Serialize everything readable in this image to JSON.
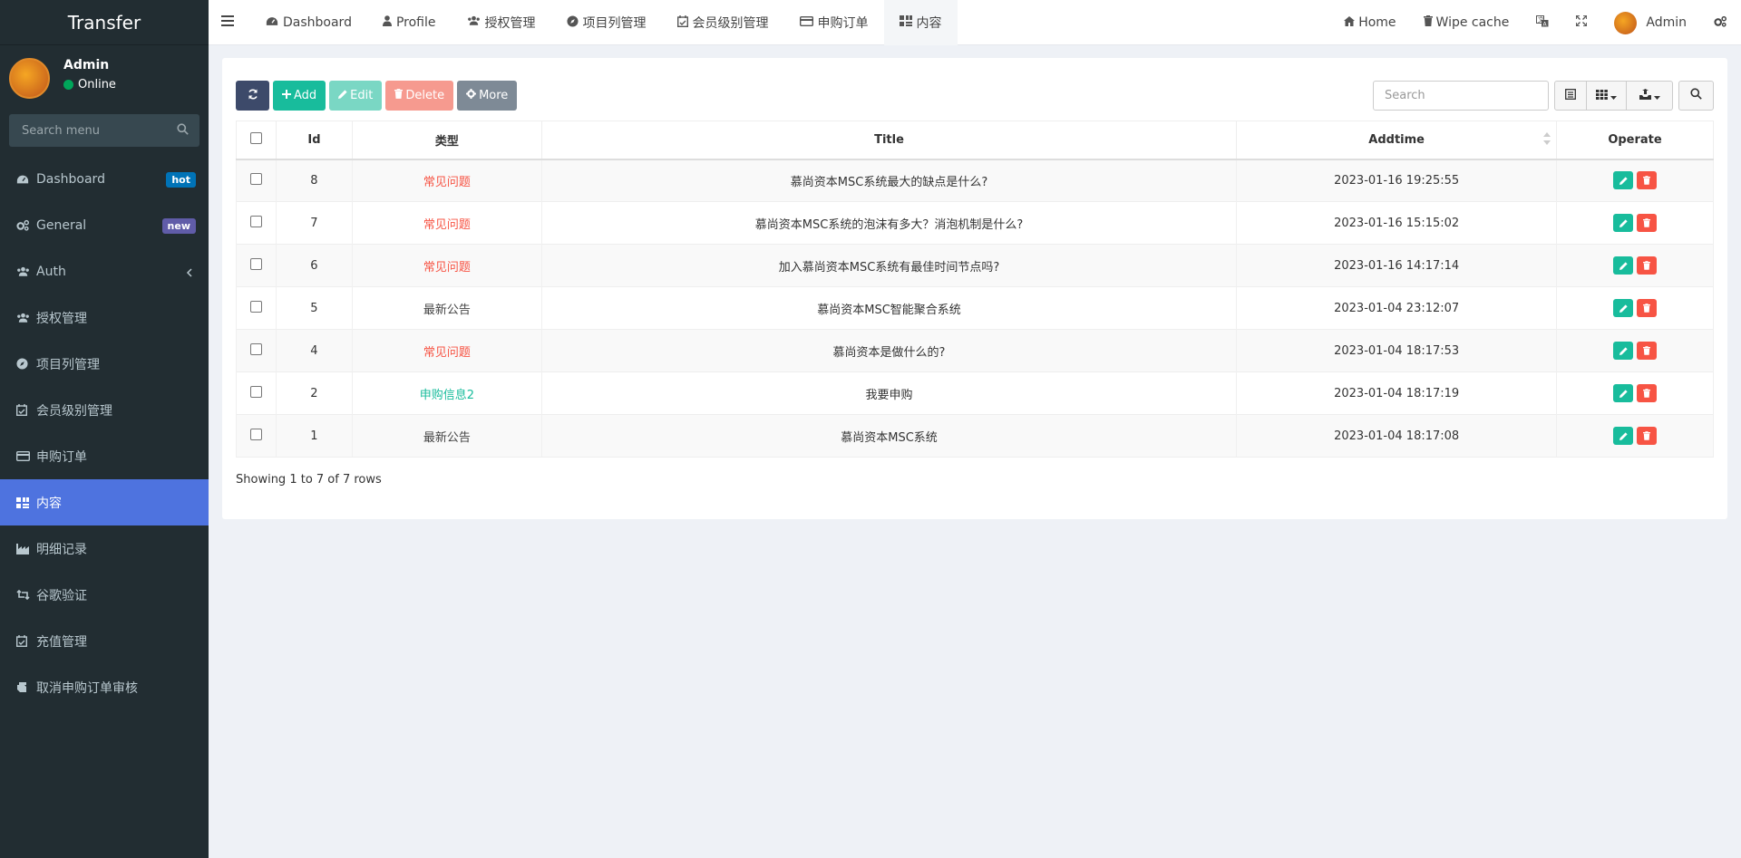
{
  "brand": "Transfer",
  "user": {
    "name": "Admin",
    "status": "Online",
    "avatar_text": ""
  },
  "sidebar": {
    "search_placeholder": "Search menu",
    "items": [
      {
        "label": "Dashboard",
        "icon": "dashboard-icon",
        "badge": "hot"
      },
      {
        "label": "General",
        "icon": "cogs-icon",
        "badge": "new"
      },
      {
        "label": "Auth",
        "icon": "users-icon",
        "badge": ""
      },
      {
        "label": "授权管理",
        "icon": "users-icon",
        "badge": ""
      },
      {
        "label": "项目列管理",
        "icon": "compass-icon",
        "badge": ""
      },
      {
        "label": "会员级别管理",
        "icon": "calendar-check-icon",
        "badge": ""
      },
      {
        "label": "申购订单",
        "icon": "credit-card-icon",
        "badge": ""
      },
      {
        "label": "内容",
        "icon": "qrcode-icon",
        "badge": ""
      },
      {
        "label": "明细记录",
        "icon": "industry-icon",
        "badge": ""
      },
      {
        "label": "谷歌验证",
        "icon": "retweet-icon",
        "badge": ""
      },
      {
        "label": "充值管理",
        "icon": "calendar-check-icon",
        "badge": ""
      },
      {
        "label": "取消申购订单审核",
        "icon": "hand-icon",
        "badge": ""
      }
    ]
  },
  "topbar": {
    "tabs": [
      {
        "label": "Dashboard",
        "icon": "dashboard-icon"
      },
      {
        "label": "Profile",
        "icon": "user-icon"
      },
      {
        "label": "授权管理",
        "icon": "users-icon"
      },
      {
        "label": "项目列管理",
        "icon": "compass-icon"
      },
      {
        "label": "会员级别管理",
        "icon": "calendar-check-icon"
      },
      {
        "label": "申购订单",
        "icon": "credit-card-icon"
      },
      {
        "label": "内容",
        "icon": "qrcode-icon"
      }
    ],
    "home": "Home",
    "wipe_cache": "Wipe cache",
    "admin": "Admin"
  },
  "toolbar": {
    "add": "Add",
    "edit": "Edit",
    "delete": "Delete",
    "more": "More",
    "search_placeholder": "Search"
  },
  "table": {
    "headers": {
      "id": "Id",
      "type": "类型",
      "title": "Title",
      "addtime": "Addtime",
      "operate": "Operate"
    },
    "rows": [
      {
        "id": "8",
        "type": "常见问题",
        "type_color": "#f75444",
        "title": "慕尚资本MSC系统最大的缺点是什么?",
        "addtime": "2023-01-16 19:25:55"
      },
      {
        "id": "7",
        "type": "常见问题",
        "type_color": "#f75444",
        "title": "慕尚资本MSC系统的泡沫有多大？消泡机制是什么?",
        "addtime": "2023-01-16 15:15:02"
      },
      {
        "id": "6",
        "type": "常见问题",
        "type_color": "#f75444",
        "title": "加入慕尚资本MSC系统有最佳时间节点吗?",
        "addtime": "2023-01-16 14:17:14"
      },
      {
        "id": "5",
        "type": "最新公告",
        "type_color": "#444444",
        "title": "慕尚资本MSC智能聚合系统",
        "addtime": "2023-01-04 23:12:07"
      },
      {
        "id": "4",
        "type": "常见问题",
        "type_color": "#f75444",
        "title": "慕尚资本是做什么的?",
        "addtime": "2023-01-04 18:17:53"
      },
      {
        "id": "2",
        "type": "申购信息2",
        "type_color": "#18bc9c",
        "title": "我要申购",
        "addtime": "2023-01-04 18:17:19"
      },
      {
        "id": "1",
        "type": "最新公告",
        "type_color": "#444444",
        "title": "慕尚资本MSC系统",
        "addtime": "2023-01-04 18:17:08"
      }
    ],
    "footer": "Showing 1 to 7 of 7 rows"
  }
}
